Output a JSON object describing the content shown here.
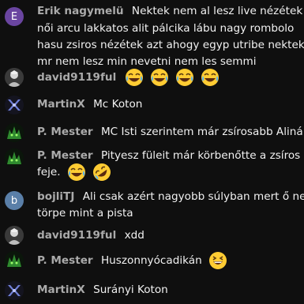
{
  "colors": {
    "background": "#0f0f0f",
    "author": "#aaaaaa",
    "message": "#f1f1f1",
    "avatar_e": "#6a45a0",
    "avatar_b": "#5a7fa8"
  },
  "messages": [
    {
      "author": "Erik nagymelü",
      "avatar_letter": "E",
      "lines": [
        "Nektek nem al lesz live nézétek a",
        "női arcu lakkatos alit pálcika lábu nagy rombolo",
        "hasu zsiros nézétek azt ahogy egyp utribe nektek",
        "mr nem lesz min nevetni nem les semmi"
      ]
    },
    {
      "author": "david9119ful",
      "emojis": [
        "laughing-crying-emoji",
        "laughing-crying-emoji",
        "laughing-crying-emoji",
        "laughing-crying-emoji"
      ]
    },
    {
      "author": "MartinX",
      "text": "Mc Koton"
    },
    {
      "author": "P. Mester",
      "text": "MC Isti szerintem már zsírosabb Alinál."
    },
    {
      "author": "P. Mester",
      "lines": [
        "Pityesz füleit már körbenőtte a zsíros",
        "feje."
      ],
      "emojis": [
        "laughing-crying-emoji",
        "rofl-emoji"
      ]
    },
    {
      "author": "bojliTJ",
      "avatar_letter": "b",
      "lines": [
        "Ali csak azért nagyobb súlyban mert ő nem",
        "törpe mint a pista"
      ]
    },
    {
      "author": "david9119ful",
      "text": "xdd"
    },
    {
      "author": "P. Mester",
      "text": "Huszonnyócadikán",
      "emojis": [
        "grinning-squinting-emoji"
      ]
    },
    {
      "author": "MartinX",
      "text": "Surányi Koton"
    }
  ]
}
